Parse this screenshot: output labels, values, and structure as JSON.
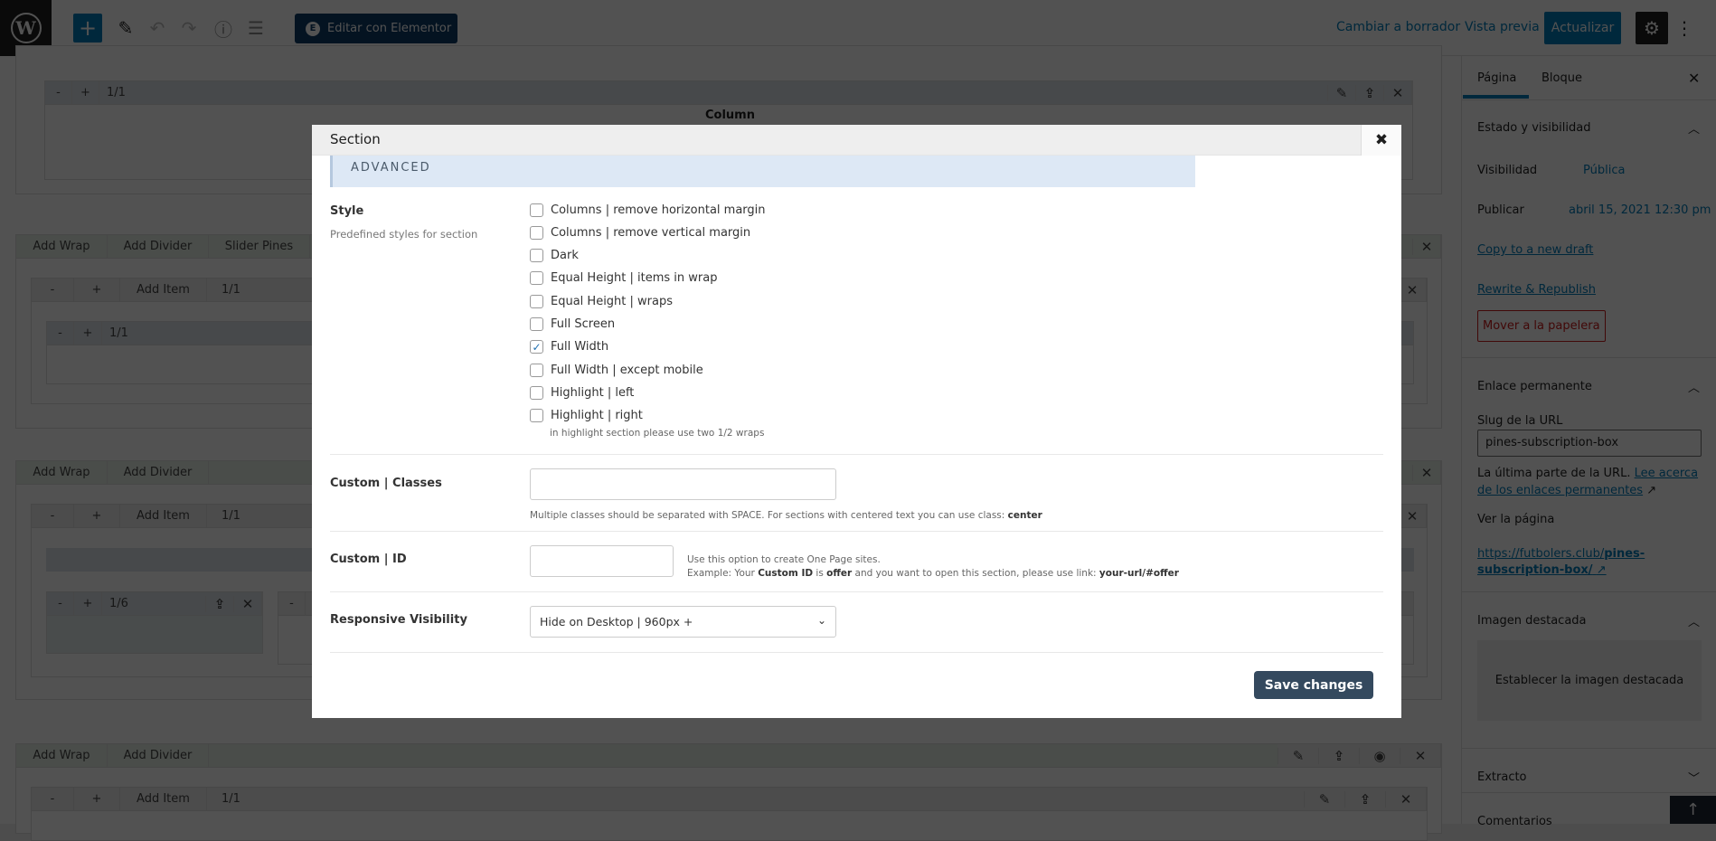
{
  "topbar": {
    "logo": "W",
    "add": "+",
    "edit_icon": "pencil-icon",
    "elementor_label": "Editar con Elementor",
    "switch_draft": "Cambiar a borrador",
    "preview": "Vista previa",
    "update": "Actualizar"
  },
  "editor": {
    "block1": {
      "minus": "-",
      "plus": "+",
      "ratio": "1/1",
      "column_label": "Column"
    },
    "block2": {
      "buttons": [
        "Add Wrap",
        "Add Divider",
        "Slider Pines"
      ],
      "row": [
        "-",
        "+",
        "Add Item",
        "1/1"
      ],
      "inner": [
        "-",
        "+",
        "1/1"
      ]
    },
    "block3": {
      "buttons": [
        "Add Wrap",
        "Add Divider"
      ],
      "row": [
        "-",
        "+",
        "Add Item",
        "1/1"
      ],
      "col": [
        "-",
        "+",
        "1/6"
      ],
      "col2": [
        "-"
      ]
    },
    "block4": {
      "buttons": [
        "Add Wrap",
        "Add Divider"
      ],
      "row": [
        "-",
        "+",
        "Add Item",
        "1/1"
      ]
    }
  },
  "modal": {
    "title": "Section",
    "section_heading": "ADVANCED",
    "style": {
      "label": "Style",
      "description": "Predefined styles for section",
      "options": [
        {
          "label": "Columns | remove horizontal margin",
          "checked": false
        },
        {
          "label": "Columns | remove vertical margin",
          "checked": false
        },
        {
          "label": "Dark",
          "checked": false
        },
        {
          "label": "Equal Height | items in wrap",
          "checked": false
        },
        {
          "label": "Equal Height | wraps",
          "checked": false
        },
        {
          "label": "Full Screen",
          "checked": false
        },
        {
          "label": "Full Width",
          "checked": true
        },
        {
          "label": "Full Width | except mobile",
          "checked": false
        },
        {
          "label": "Highlight | left",
          "checked": false
        },
        {
          "label": "Highlight | right",
          "checked": false
        }
      ],
      "note": "in highlight section please use two 1/2 wraps"
    },
    "custom_classes": {
      "label": "Custom | Classes",
      "value": "",
      "help": "Multiple classes should be separated with SPACE. For sections with centered text you can use class: ",
      "help_bold": "center"
    },
    "custom_id": {
      "label": "Custom | ID",
      "value": "",
      "help1": "Use this option to create One Page sites.",
      "help2a": "Example: Your ",
      "help2b": "Custom ID",
      "help2c": " is ",
      "help2d": "offer",
      "help2e": " and you want to open this section, please use link: ",
      "help2f": "your-url/#offer"
    },
    "responsive": {
      "label": "Responsive Visibility",
      "selected": "Hide on Desktop | 960px +"
    },
    "save": "Save changes"
  },
  "sidebar": {
    "tabs": [
      "Página",
      "Bloque"
    ],
    "active_tab": "Página",
    "status": {
      "title": "Estado y visibilidad",
      "visibility_label": "Visibilidad",
      "visibility_value": "Pública",
      "publish_label": "Publicar",
      "publish_value": "abril 15, 2021 12:30 pm",
      "copy": "Copy to a new draft",
      "rewrite": "Rewrite & Republish",
      "trash": "Mover a la papelera"
    },
    "permalink": {
      "title": "Enlace permanente",
      "slug_label": "Slug de la URL",
      "slug_value": "pines-subscription-box",
      "help": "La última parte de la URL. ",
      "help_link": "Lee acerca de los enlaces permanentes",
      "view_label": "Ver la página",
      "url_a": "https://futbolers.club/",
      "url_b": "pines-subscription-box/"
    },
    "featured": {
      "title": "Imagen destacada",
      "button": "Establecer la imagen destacada"
    },
    "excerpt": "Extracto",
    "comments": "Comentarios"
  },
  "colors": {
    "primary": "#007cba",
    "save_button": "#34495e",
    "advanced_band": "#dde8f5",
    "trash": "#cc1818"
  }
}
